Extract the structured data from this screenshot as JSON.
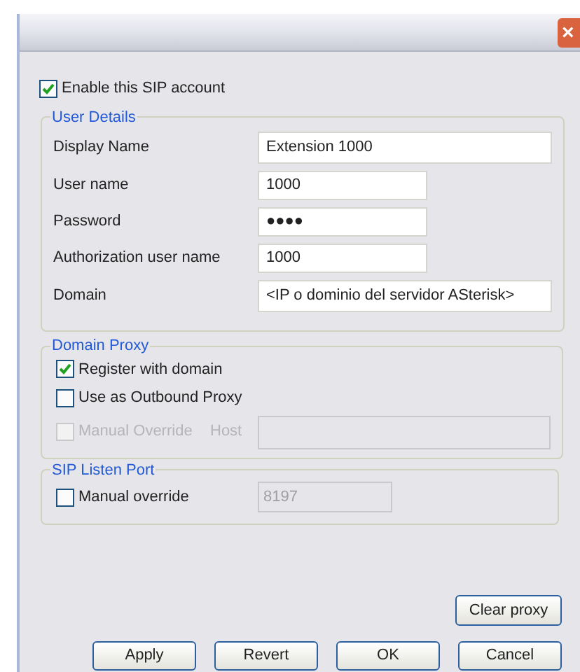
{
  "window": {
    "close": "×"
  },
  "enable_account": {
    "label": "Enable this SIP account",
    "checked": true,
    "disabled": false
  },
  "user_details": {
    "title": "User Details",
    "fields": [
      {
        "label": "Display Name",
        "value": "Extension 1000",
        "kind": "wide"
      },
      {
        "label": "User name",
        "value": "1000",
        "kind": "short"
      },
      {
        "label": "Password",
        "value": "●●●●",
        "kind": "short"
      },
      {
        "label": "Authorization user name",
        "value": "1000",
        "kind": "short"
      },
      {
        "label": "Domain",
        "value": "<IP o dominio del servidor ASterisk>",
        "kind": "wide"
      }
    ]
  },
  "domain_proxy": {
    "title": "Domain Proxy",
    "options": [
      {
        "label": "Register with domain",
        "checked": true,
        "disabled": false
      },
      {
        "label": "Use as Outbound Proxy",
        "checked": false,
        "disabled": false
      },
      {
        "label": "Manual Override",
        "checked": false,
        "disabled": true
      }
    ],
    "host": {
      "label": "Host",
      "disabled": true
    }
  },
  "sip_listen_port": {
    "title": "SIP Listen Port",
    "option": {
      "label": "Manual override",
      "checked": false,
      "disabled": false
    },
    "port": {
      "value": "8197",
      "disabled": true
    }
  },
  "clear_proxy": "Clear proxy",
  "buttons": [
    "Apply",
    "Revert",
    "OK",
    "Cancel"
  ]
}
